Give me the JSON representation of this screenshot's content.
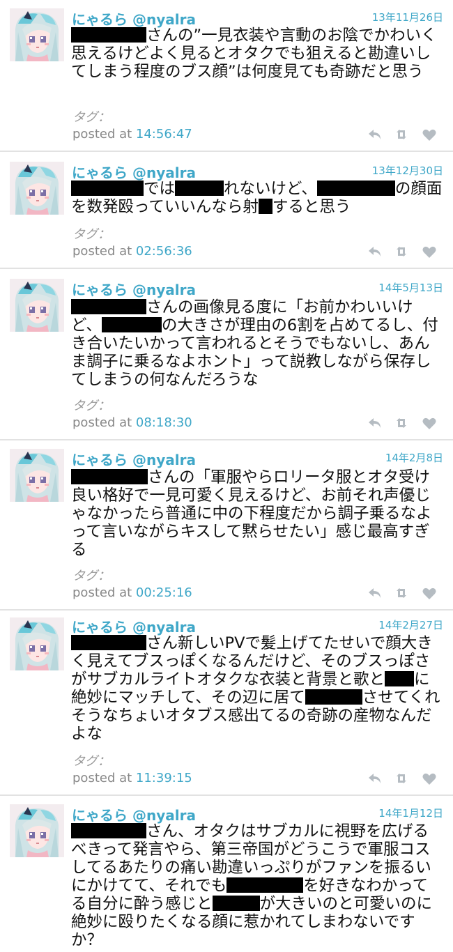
{
  "posts": [
    {
      "user": "にゃるら @nyalra",
      "date": "13年11月26日",
      "segments": [
        {
          "redact": 108
        },
        {
          "text": "さんの”一見衣装や言動のお陰でかわいく思えるけどよく見るとオタクでも狙えると勘違いしてしまう程度のブス顔”は何度見ても奇跡だと思う"
        }
      ],
      "tag": "タグ：",
      "time_prefix": "posted at ",
      "time": "14:56:47"
    },
    {
      "user": "にゃるら @nyalra",
      "date": "13年12月30日",
      "segments": [
        {
          "redact": 104
        },
        {
          "text": "では"
        },
        {
          "redact": 70
        },
        {
          "text": "れないけど、"
        },
        {
          "redact": 112
        },
        {
          "text": "の顔面を数発殴っていいんなら射"
        },
        {
          "redact": 20
        },
        {
          "text": "すると思う"
        }
      ],
      "tag": "タグ：",
      "time_prefix": "posted at ",
      "time": "02:56:36"
    },
    {
      "user": "にゃるら @nyalra",
      "date": "14年5月13日",
      "segments": [
        {
          "redact": 108
        },
        {
          "text": "さんの画像見る度に「お前かわいいけど、"
        },
        {
          "redact": 86
        },
        {
          "text": "の大きさが理由の6割を占めてるし、付き合いたいかって言われるとそうでもないし、あんま調子に乗るなよホント」って説教しながら保存してしまうの何なんだろうな"
        }
      ],
      "tag": "タグ：",
      "time_prefix": "posted at ",
      "time": "08:18:30"
    },
    {
      "user": "にゃるら @nyalra",
      "date": "14年2月8日",
      "segments": [
        {
          "redact": 110
        },
        {
          "text": "さんの「軍服やらロリータ服とオタ受け良い格好で一見可愛く見えるけど、お前それ声優じゃなかったら普通に中の下程度だから調子乗るなよって言いながらキスして黙らせたい」感じ最高すぎる"
        }
      ],
      "tag": "タグ：",
      "time_prefix": "posted at ",
      "time": "00:25:16"
    },
    {
      "user": "にゃるら @nyalra",
      "date": "14年2月27日",
      "segments": [
        {
          "redact": 108
        },
        {
          "text": "さん新しいPVで髪上げてたせいで顔大きく見えてブスっぽくなるんだけど、そのブスっぽさがサブカルライトオタクな衣装と背景と歌と"
        },
        {
          "redact": 42
        },
        {
          "text": "に絶妙にマッチして、その辺に居て"
        },
        {
          "redact": 82
        },
        {
          "text": "させてくれそうなちょいオタブス感出てるの奇跡の産物なんだよな"
        }
      ],
      "tag": "タグ：",
      "time_prefix": "posted at ",
      "time": "11:39:15"
    },
    {
      "user": "にゃるら @nyalra",
      "date": "14年1月12日",
      "segments": [
        {
          "redact": 108
        },
        {
          "text": "さん、オタクはサブカルに視野を広げるべきって発言やら、第三帝国がどうこうで軍服コスしてるあたりの痛い勘違いっぷりがファンを振るいにかけてて、それでも"
        },
        {
          "redact": 110
        },
        {
          "text": "を好きなわかってる自分に酔う感じと"
        },
        {
          "redact": 68
        },
        {
          "text": "が大きいのと可愛いのに絶妙に殴りたくなる顔に惹かれてしまわないですか？"
        }
      ],
      "tag": "",
      "time_prefix": "",
      "time": ""
    }
  ],
  "icons": {
    "reply": "reply-icon",
    "retweet": "retweet-icon",
    "favorite": "heart-icon",
    "avatar": "anime-girl-avatar"
  },
  "colors": {
    "accent": "#3fa7c8",
    "text": "#111111",
    "muted": "#888888",
    "icon": "#b5bcc2",
    "divider": "#e2e2e2"
  }
}
